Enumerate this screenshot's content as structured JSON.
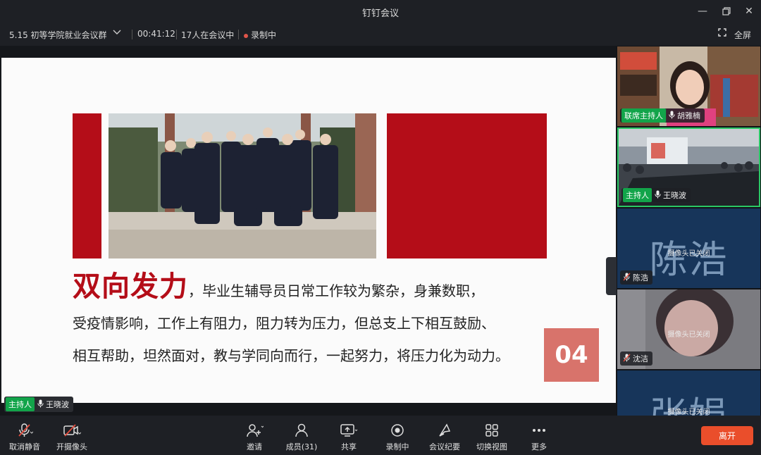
{
  "window": {
    "title": "钉钉会议"
  },
  "info": {
    "meeting_name": "5.15 初等学院就业会议群",
    "duration": "00:41:12",
    "participants": "17人在会议中",
    "recording": "录制中",
    "fullscreen": "全屏"
  },
  "slide": {
    "headline": "双向发力",
    "line1": "，毕业生辅导员日常工作较为繁杂，身兼数职，",
    "line2": "受疫情影响，工作上有阻力，阻力转为压力，但总支上下相互鼓励、",
    "line3": "相互帮助，坦然面对，教与学同向而行，一起努力，将压力化为动力。",
    "number": "04"
  },
  "presenter": {
    "role": "主持人",
    "name": "王晓波"
  },
  "videos": [
    {
      "role": "联席主持人",
      "name": "胡雅楠"
    },
    {
      "role": "主持人",
      "name": "王晓波"
    },
    {
      "name": "陈浩",
      "bigname": "陈浩",
      "status": "摄像头已关闭"
    },
    {
      "name": "沈洁",
      "status": "摄像头已关闭"
    },
    {
      "bigname": "张娟",
      "status": "摄像头已关闭"
    }
  ],
  "toolbar": {
    "unmute": "取消静音",
    "camera": "开摄像头",
    "invite": "邀请",
    "members": "成员(31)",
    "share": "共享",
    "record": "录制中",
    "minutes": "会议纪要",
    "switch_view": "切换视图",
    "more": "更多",
    "leave": "离开"
  },
  "colors": {
    "slide_red": "#b40d18",
    "host_green": "#12a44a",
    "leave": "#ea4e2b"
  }
}
